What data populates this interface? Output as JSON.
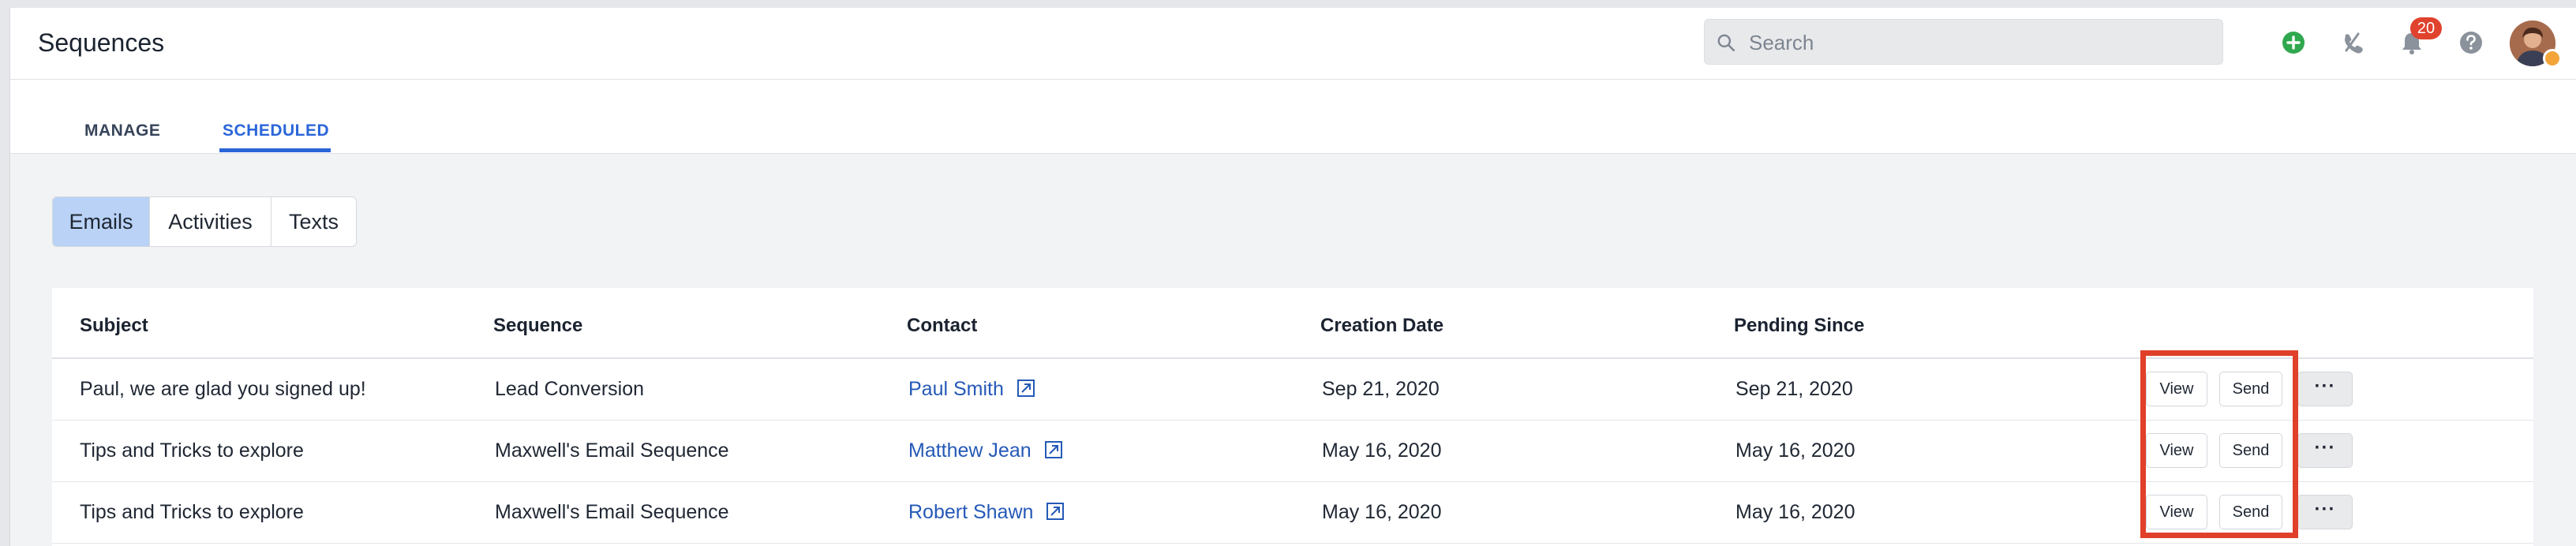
{
  "header": {
    "title": "Sequences",
    "search_placeholder": "Search",
    "notification_count": "20",
    "icons": [
      "add-icon",
      "phone-off-icon",
      "bell-icon",
      "help-icon"
    ]
  },
  "tabs": [
    {
      "label": "MANAGE",
      "active": false
    },
    {
      "label": "SCHEDULED",
      "active": true
    }
  ],
  "segments": [
    {
      "label": "Emails",
      "active": true
    },
    {
      "label": "Activities",
      "active": false
    },
    {
      "label": "Texts",
      "active": false
    }
  ],
  "table": {
    "columns": [
      "Subject",
      "Sequence",
      "Contact",
      "Creation Date",
      "Pending Since"
    ],
    "rows": [
      {
        "subject": "Paul, we are glad you signed up!",
        "sequence": "Lead Conversion",
        "contact": "Paul Smith",
        "creation_date": "Sep 21, 2020",
        "pending_since": "Sep 21, 2020"
      },
      {
        "subject": "Tips and Tricks to explore",
        "sequence": "Maxwell's Email Sequence",
        "contact": "Matthew Jean",
        "creation_date": "May 16, 2020",
        "pending_since": "May 16, 2020"
      },
      {
        "subject": "Tips and Tricks to explore",
        "sequence": "Maxwell's Email Sequence",
        "contact": "Robert Shawn",
        "creation_date": "May 16, 2020",
        "pending_since": "May 16, 2020"
      }
    ],
    "actions": {
      "view_label": "View",
      "send_label": "Send",
      "more_label": "···"
    }
  },
  "colors": {
    "accent": "#2b66d9",
    "link": "#2559b7",
    "active_segment": "#b9d2f6",
    "badge": "#e0422d",
    "add_icon": "#2fa84f",
    "highlight_box": "#e0402a"
  }
}
